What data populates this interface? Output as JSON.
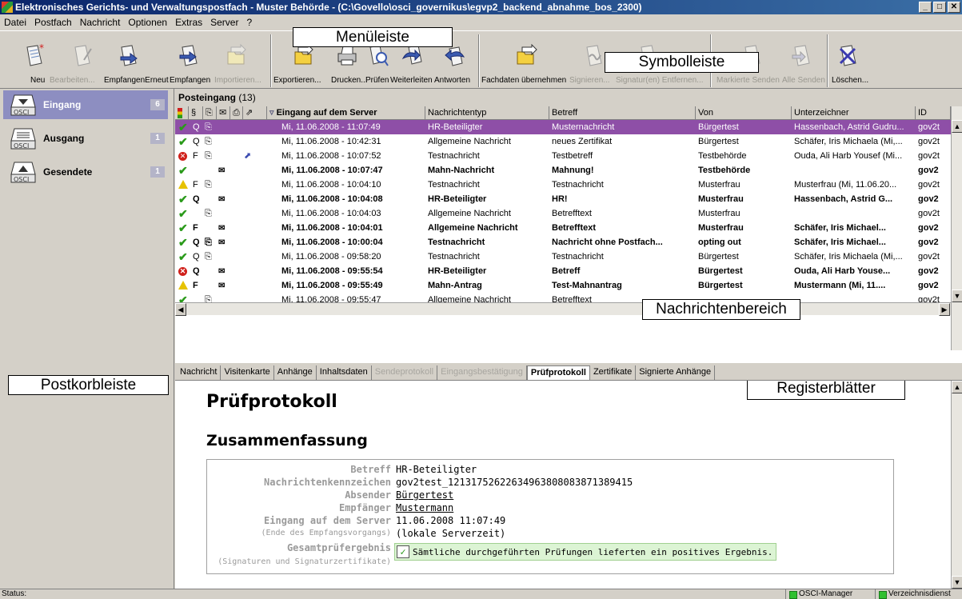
{
  "window": {
    "title": "Elektronisches Gerichts- und Verwaltungspostfach - Muster Behörde - (C:\\Govello\\osci_governikus\\egvp2_backend_abnahme_bos_2300)",
    "min": "_",
    "max": "□",
    "close": "✕"
  },
  "menu": [
    "Datei",
    "Postfach",
    "Nachricht",
    "Optionen",
    "Extras",
    "Server",
    "?"
  ],
  "callouts": {
    "menu": "Menüleiste",
    "toolbar": "Symbolleiste",
    "sidebar": "Postkorbleiste",
    "messages": "Nachrichtenbereich",
    "tabs": "Registerblätter"
  },
  "toolbar": {
    "new": "Neu",
    "edit": "Bearbeiten...",
    "resend": "EmpfangenErneut",
    "receive": "Empfangen",
    "import": "Importieren...",
    "export": "Exportieren...",
    "print": "Drucken...",
    "check": "Prüfen",
    "forward": "Weiterleiten",
    "reply": "Antworten",
    "fachdaten": "Fachdaten übernehmen",
    "sign": "Signieren...",
    "remove_sig": "Signatur(en) Entfernen...",
    "send_marked": "Markierte Senden",
    "send_all": "Alle Senden",
    "delete": "Löschen..."
  },
  "sidebar": {
    "items": [
      {
        "name": "Eingang",
        "count": "6"
      },
      {
        "name": "Ausgang",
        "count": "1"
      },
      {
        "name": "Gesendete",
        "count": "1"
      }
    ]
  },
  "inbox": {
    "title": "Posteingang",
    "count": "(13)",
    "columns": {
      "para": "§",
      "received": "Eingang auf dem Server",
      "type": "Nachrichtentyp",
      "subject": "Betreff",
      "from": "Von",
      "signer": "Unterzeichner",
      "id": "ID"
    },
    "rows": [
      {
        "status": "ok",
        "para": "Q",
        "att": "true",
        "env": "",
        "fwd": "",
        "date": "Mi, 11.06.2008 - 11:07:49",
        "type": "HR-Beteiligter",
        "subject": "Musternachricht",
        "from": "Bürgertest",
        "signer": "Hassenbach, Astrid Gudru...",
        "id": "gov2t",
        "bold": "false",
        "sel": "true"
      },
      {
        "status": "ok",
        "para": "Q",
        "att": "true",
        "env": "",
        "fwd": "",
        "date": "Mi, 11.06.2008 - 10:42:31",
        "type": "Allgemeine Nachricht",
        "subject": "neues Zertifikat",
        "from": "Bürgertest",
        "signer": "Schäfer, Iris Michaela (Mi,...",
        "id": "gov2t",
        "bold": "false",
        "sel": "false"
      },
      {
        "status": "err",
        "para": "F",
        "att": "true",
        "env": "",
        "fwd": "true",
        "date": "Mi, 11.06.2008 - 10:07:52",
        "type": "Testnachricht",
        "subject": "Testbetreff",
        "from": "Testbehörde",
        "signer": "Ouda, Ali Harb Yousef (Mi...",
        "id": "gov2t",
        "bold": "false",
        "sel": "false"
      },
      {
        "status": "ok",
        "para": "",
        "att": "",
        "env": "true",
        "fwd": "",
        "date": "Mi, 11.06.2008 - 10:07:47",
        "type": "Mahn-Nachricht",
        "subject": "Mahnung!",
        "from": "Testbehörde",
        "signer": "",
        "id": "gov2",
        "bold": "true",
        "sel": "false"
      },
      {
        "status": "warn",
        "para": "F",
        "att": "true",
        "env": "",
        "fwd": "",
        "date": "Mi, 11.06.2008 - 10:04:10",
        "type": "Testnachricht",
        "subject": "Testnachricht",
        "from": "Musterfrau",
        "signer": "Musterfrau (Mi, 11.06.20...",
        "id": "gov2t",
        "bold": "false",
        "sel": "false"
      },
      {
        "status": "ok",
        "para": "Q",
        "att": "",
        "env": "true",
        "fwd": "",
        "date": "Mi, 11.06.2008 - 10:04:08",
        "type": "HR-Beteiligter",
        "subject": "HR!",
        "from": "Musterfrau",
        "signer": "Hassenbach, Astrid G...",
        "id": "gov2",
        "bold": "true",
        "sel": "false"
      },
      {
        "status": "ok",
        "para": "",
        "att": "true",
        "env": "",
        "fwd": "",
        "date": "Mi, 11.06.2008 - 10:04:03",
        "type": "Allgemeine Nachricht",
        "subject": "Betrefftext",
        "from": "Musterfrau",
        "signer": "",
        "id": "gov2t",
        "bold": "false",
        "sel": "false"
      },
      {
        "status": "ok",
        "para": "F",
        "att": "",
        "env": "true",
        "fwd": "",
        "date": "Mi, 11.06.2008 - 10:04:01",
        "type": "Allgemeine Nachricht",
        "subject": "Betrefftext",
        "from": "Musterfrau",
        "signer": "Schäfer, Iris Michael...",
        "id": "gov2",
        "bold": "true",
        "sel": "false"
      },
      {
        "status": "ok",
        "para": "Q",
        "att": "true",
        "env": "true",
        "fwd": "",
        "date": "Mi, 11.06.2008 - 10:00:04",
        "type": "Testnachricht",
        "subject": "Nachricht ohne Postfach...",
        "from": "opting out",
        "signer": "Schäfer, Iris Michael...",
        "id": "gov2",
        "bold": "true",
        "sel": "false"
      },
      {
        "status": "ok",
        "para": "Q",
        "att": "true",
        "env": "",
        "fwd": "",
        "date": "Mi, 11.06.2008 - 09:58:20",
        "type": "Testnachricht",
        "subject": "Testnachricht",
        "from": "Bürgertest",
        "signer": "Schäfer, Iris Michaela (Mi,...",
        "id": "gov2t",
        "bold": "false",
        "sel": "false"
      },
      {
        "status": "err",
        "para": "Q",
        "att": "",
        "env": "true",
        "fwd": "",
        "date": "Mi, 11.06.2008 - 09:55:54",
        "type": "HR-Beteiligter",
        "subject": "Betreff",
        "from": "Bürgertest",
        "signer": "Ouda, Ali Harb Youse...",
        "id": "gov2",
        "bold": "true",
        "sel": "false"
      },
      {
        "status": "warn",
        "para": "F",
        "att": "",
        "env": "true",
        "fwd": "",
        "date": "Mi, 11.06.2008 - 09:55:49",
        "type": "Mahn-Antrag",
        "subject": "Test-Mahnantrag",
        "from": "Bürgertest",
        "signer": "Mustermann (Mi, 11....",
        "id": "gov2",
        "bold": "true",
        "sel": "false"
      },
      {
        "status": "ok",
        "para": "",
        "att": "true",
        "env": "",
        "fwd": "",
        "date": "Mi, 11.06.2008 - 09:55:47",
        "type": "Allgemeine Nachricht",
        "subject": "Betrefftext",
        "from": "",
        "signer": "",
        "id": "gov2t",
        "bold": "false",
        "sel": "false"
      }
    ]
  },
  "tabs": [
    {
      "label": "Nachricht",
      "state": "normal"
    },
    {
      "label": "Visitenkarte",
      "state": "normal"
    },
    {
      "label": "Anhänge",
      "state": "normal"
    },
    {
      "label": "Inhaltsdaten",
      "state": "normal"
    },
    {
      "label": "Sendeprotokoll",
      "state": "disabled"
    },
    {
      "label": "Eingangsbestätigung",
      "state": "disabled"
    },
    {
      "label": "Prüfprotokoll",
      "state": "active"
    },
    {
      "label": "Zertifikate",
      "state": "normal"
    },
    {
      "label": "Signierte Anhänge",
      "state": "normal"
    }
  ],
  "report": {
    "title": "Prüfprotokoll",
    "summary_title": "Zusammenfassung",
    "fields": {
      "subject_k": "Betreff",
      "subject_v": "HR-Beteiligter",
      "msgid_k": "Nachrichtenkennzeichen",
      "msgid_v": "gov2test_1213175262263496380808387138941​5",
      "sender_k": "Absender",
      "sender_v": "Bürgertest",
      "recipient_k": "Empfänger",
      "recipient_v": "Mustermann",
      "received_k": "Eingang auf dem Server",
      "received_v": "11.06.2008 11:07:49",
      "received_note_k": "(Ende des Empfangsvorgangs)",
      "received_note_v": "(lokale Serverzeit)",
      "result_k": "Gesamtprüfergebnis",
      "result_sub_k": "(Signaturen und Signaturzertifikate)",
      "result_v": "Sämtliche durchgeführten Prüfungen lieferten ein positives Ergebnis."
    }
  },
  "status": {
    "label": "Status:",
    "osci": "OSCI-Manager",
    "dir": "Verzeichnisdienst"
  },
  "colors": {
    "selected_row": "#8e4fa7",
    "sidebar_selected": "#8d8ec1",
    "result_bg": "#dcf4d4"
  }
}
